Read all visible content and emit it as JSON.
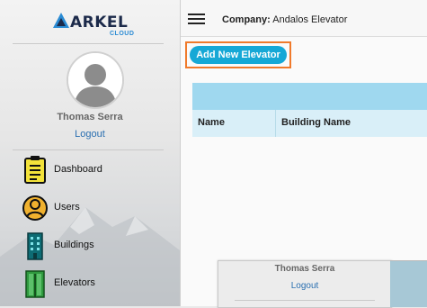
{
  "brand": {
    "logo_text": "ARKEL",
    "logo_sub": "CLOUD"
  },
  "user": {
    "name": "Thomas Serra",
    "logout_label": "Logout"
  },
  "nav": {
    "items": [
      {
        "label": "Dashboard",
        "icon": "dashboard-icon"
      },
      {
        "label": "Users",
        "icon": "user-icon"
      },
      {
        "label": "Buildings",
        "icon": "building-icon"
      },
      {
        "label": "Elevators",
        "icon": "elevator-icon"
      }
    ]
  },
  "header": {
    "company_label": "Company:",
    "company_name": "Andalos Elevator"
  },
  "main": {
    "add_button_label": "Add New Elevator",
    "table": {
      "columns": [
        "Name",
        "Building Name"
      ]
    }
  },
  "popup": {
    "name": "Thomas Serra",
    "logout_label": "Logout"
  },
  "colors": {
    "accent": "#16a8d6",
    "highlight": "#f07a2b",
    "table_band": "#9fd8ef",
    "table_header": "#d9eff8"
  }
}
